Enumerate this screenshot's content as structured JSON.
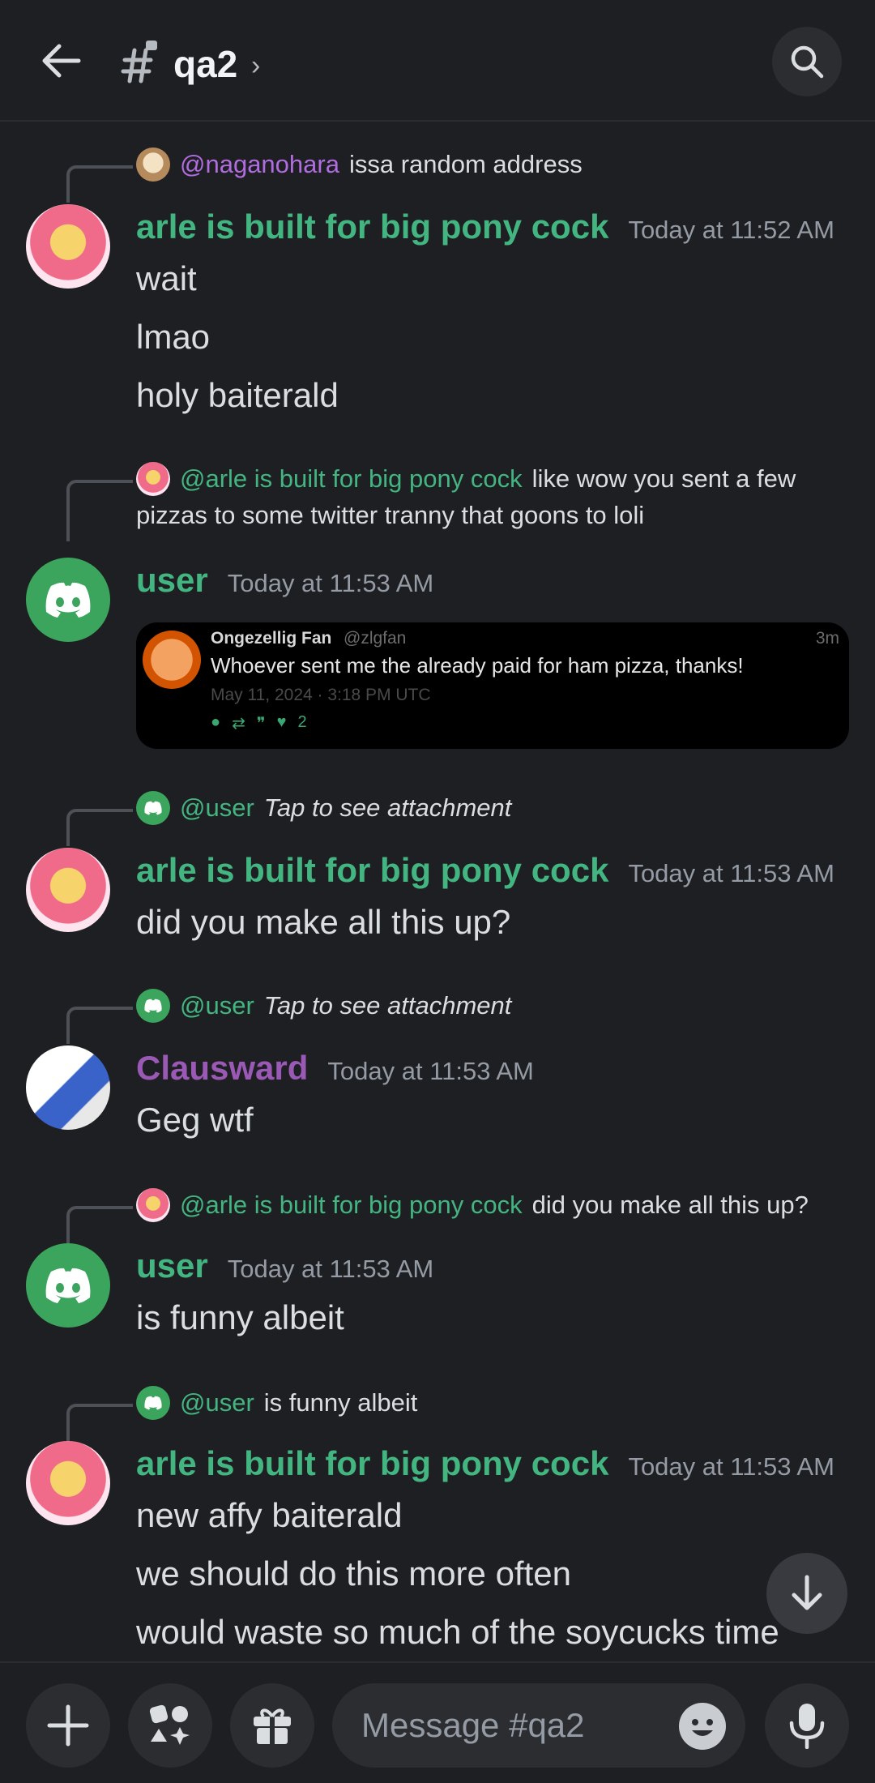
{
  "header": {
    "channel_name": "qa2",
    "chevron": "›"
  },
  "messages": [
    {
      "reply": {
        "mention": "@naganohara",
        "text": "issa random address"
      },
      "author": "arle is built for big pony cock",
      "timestamp": "Today at 11:52 AM",
      "lines": [
        "wait",
        "lmao",
        "holy baiterald"
      ]
    },
    {
      "reply": {
        "mention": "@arle is built for big pony cock",
        "text": "like wow you sent a few",
        "text2": "pizzas to some twitter tranny that goons to loli"
      },
      "author": "user",
      "timestamp": "Today at 11:53 AM",
      "embed": {
        "name": "Ongezellig Fan",
        "handle": "@zlgfan",
        "time": "3m",
        "text": "Whoever sent me the already paid for ham pizza, thanks!",
        "date": "May 11, 2024 · 3:18 PM UTC",
        "likes": "2"
      }
    },
    {
      "reply": {
        "mention": "@user",
        "text": "Tap to see attachment"
      },
      "author": "arle is built for big pony cock",
      "timestamp": "Today at 11:53 AM",
      "lines": [
        "did you make all this up?"
      ]
    },
    {
      "reply": {
        "mention": "@user",
        "text": "Tap to see attachment"
      },
      "author": "Clausward",
      "timestamp": "Today at 11:53 AM",
      "lines": [
        "Geg wtf"
      ]
    },
    {
      "reply": {
        "mention": "@arle is built for big pony cock",
        "text": "did you make all this up?"
      },
      "author": "user",
      "timestamp": "Today at 11:53 AM",
      "lines": [
        "is funny albeit"
      ]
    },
    {
      "reply": {
        "mention": "@user",
        "text": "is funny albeit"
      },
      "author": "arle is built for big pony cock",
      "timestamp": "Today at 11:53 AM",
      "lines": [
        "new affy baiterald",
        "we should do this more often",
        "would waste so much of the soycucks time"
      ]
    }
  ],
  "composer": {
    "placeholder": "Message #qa2"
  },
  "colors": {
    "background": "#1e1f22",
    "green_name": "#43b581",
    "purple_name": "#9b59b6",
    "mention_purple": "#b16ce0",
    "discord_green": "#3ba55d"
  },
  "icons": [
    "back-arrow-icon",
    "channel-hash-icon",
    "search-icon",
    "arrow-down-icon",
    "plus-icon",
    "apps-icon",
    "gift-icon",
    "emoji-icon",
    "microphone-icon",
    "discord-logo-icon"
  ]
}
